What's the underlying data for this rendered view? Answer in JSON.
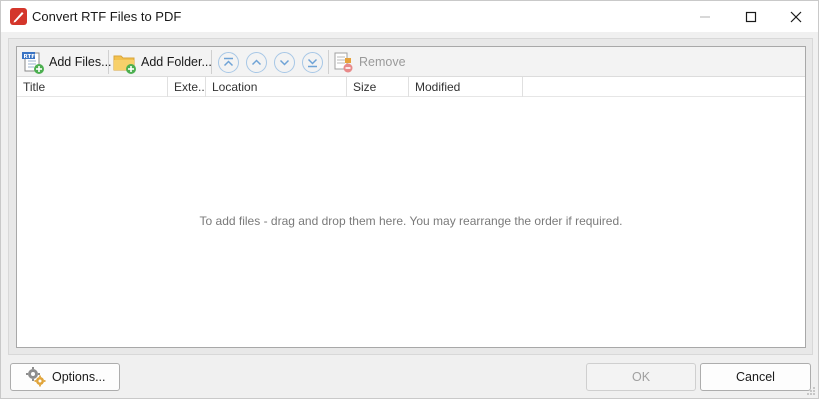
{
  "window": {
    "title": "Convert RTF Files to PDF",
    "accent_color": "#d4362b"
  },
  "titlebar_controls": {
    "minimize_icon": "minimize-icon",
    "maximize_icon": "maximize-icon",
    "close_icon": "close-icon"
  },
  "toolbar": {
    "add_files_label": "Add Files...",
    "add_folder_label": "Add Folder...",
    "move_top_icon": "chevron-double-up-icon",
    "move_up_icon": "chevron-up-icon",
    "move_down_icon": "chevron-down-icon",
    "move_bottom_icon": "chevron-double-down-icon",
    "remove_label": "Remove"
  },
  "file_list": {
    "columns": [
      "Title",
      "Exte..",
      "Location",
      "Size",
      "Modified"
    ],
    "rows": [],
    "empty_hint": "To add files - drag and drop them here. You may rearrange the order if required."
  },
  "footer": {
    "options_label": "Options...",
    "ok_label": "OK",
    "cancel_label": "Cancel"
  }
}
